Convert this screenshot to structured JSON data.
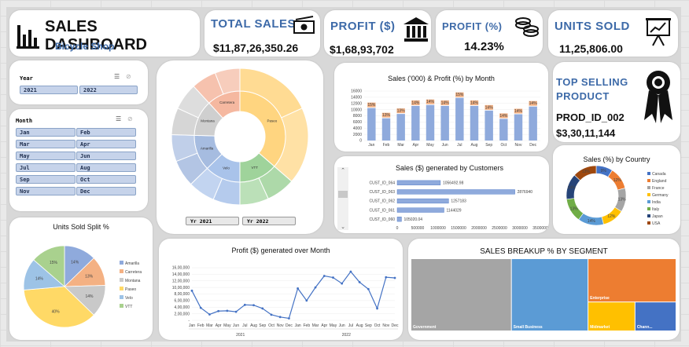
{
  "header": {
    "title": "SALES DASHBOARD",
    "subtitle": "Bicycle Shop",
    "icon": "bar-chart-icon"
  },
  "kpis": {
    "total_sales": {
      "label": "TOTAL SALES",
      "value": "$11,87,26,350.26",
      "icon": "cash-icon"
    },
    "profit_amt": {
      "label": "PROFIT ($)",
      "value": "$1,68,93,702",
      "icon": "bank-icon"
    },
    "profit_pct": {
      "label": "PROFIT (%)",
      "value": "14.23%",
      "icon": "coins-icon"
    },
    "units_sold": {
      "label": "UNITS SOLD",
      "value": "11,25,806.00",
      "icon": "presentation-icon"
    }
  },
  "top_product": {
    "label": "TOP SELLING PRODUCT",
    "product": "PROD_ID_002",
    "value": "$3,30,11,144",
    "icon": "award-ribbon-icon"
  },
  "slicers": {
    "year": {
      "title": "Year",
      "items": [
        "2021",
        "2022"
      ]
    },
    "month": {
      "title": "Month",
      "items": [
        "Jan",
        "Feb",
        "Mar",
        "Apr",
        "May",
        "Jun",
        "Jul",
        "Aug",
        "Sep",
        "Oct",
        "Nov",
        "Dec"
      ]
    }
  },
  "donut_tabs": [
    "Yr 2021",
    "Yr 2022"
  ],
  "colors": {
    "bar_blue": "#8faadc",
    "bar_orange": "#f4b183",
    "line_blue": "#4472c4",
    "treemap_gov": "#a5a5a5",
    "treemap_small": "#5b9bd5",
    "treemap_ent": "#ed7d31",
    "treemap_mid": "#ffc000",
    "treemap_chan": "#4472c4"
  },
  "chart_data": [
    {
      "id": "sunburst",
      "type": "pie",
      "title": "",
      "rings": {
        "inner": [
          {
            "name": "Paseo",
            "value": 40,
            "color": "#ffd580"
          },
          {
            "name": "VTT",
            "value": 15,
            "color": "#9fd39b"
          },
          {
            "name": "Velo",
            "value": 14,
            "color": "#a9c3ea"
          },
          {
            "name": "Amarilla",
            "value": 14,
            "color": "#a6bce0"
          },
          {
            "name": "Montana",
            "value": 14,
            "color": "#cfcfcf"
          },
          {
            "name": "Carretera",
            "value": 13,
            "color": "#f5b8a0"
          }
        ]
      }
    },
    {
      "id": "sales_profit_month",
      "type": "bar",
      "title": "Sales ('000) & Profit (%) by Month",
      "categories": [
        "Jan",
        "Feb",
        "Mar",
        "Apr",
        "May",
        "Jun",
        "Jul",
        "Aug",
        "Sep",
        "Oct",
        "Nov",
        "Dec"
      ],
      "series": [
        {
          "values": [
            10500,
            7200,
            8600,
            11200,
            11500,
            11200,
            13800,
            11200,
            9700,
            7000,
            8500,
            11000
          ],
          "color": "#8faadc"
        },
        {
          "values": [
            15,
            13,
            13,
            14,
            14,
            14,
            15,
            14,
            14,
            14,
            14,
            14
          ],
          "color": "#f4b183"
        }
      ],
      "ylim": [
        0,
        16000
      ],
      "yticks": [
        0,
        2000,
        4000,
        6000,
        8000,
        10000,
        12000,
        14000,
        16000
      ]
    },
    {
      "id": "sales_customers",
      "type": "bar",
      "title": "Sales ($) generated by Customers",
      "categories": [
        "CUST_ID_064",
        "CUST_ID_063",
        "CUST_ID_062",
        "CUST_ID_061",
        "CUST_ID_060"
      ],
      "values": [
        1056492.98,
        2876940,
        1257183,
        1144029,
        105020.04
      ],
      "labels": [
        "1056492.98",
        "2876940",
        "1257183",
        "1144029",
        "105020.04"
      ],
      "xlim": [
        0,
        3500000
      ],
      "xticks": [
        "0",
        "500000",
        "1000000",
        "1500000",
        "2000000",
        "2500000",
        "3000000",
        "3500000"
      ]
    },
    {
      "id": "sales_country",
      "type": "pie",
      "title": "Sales (%) by Country",
      "categories": [
        "Canada",
        "England",
        "France",
        "Germany",
        "India",
        "Italy",
        "Japan",
        "USA"
      ],
      "values": [
        9,
        12,
        13,
        12,
        14,
        13,
        14,
        13
      ],
      "labels": [
        "9%",
        "12%",
        "13%",
        "12%",
        "14%",
        "13%",
        "14%",
        "13%"
      ],
      "colors": [
        "#4472c4",
        "#ed7d31",
        "#a5a5a5",
        "#ffc000",
        "#5b9bd5",
        "#70ad47",
        "#264478",
        "#9e480e"
      ]
    },
    {
      "id": "units_split",
      "type": "pie",
      "title": "Units Sold Split %",
      "categories": [
        "Amarilla",
        "Carretera",
        "Montana",
        "Paseo",
        "Velo",
        "VTT"
      ],
      "values": [
        14,
        13,
        14,
        40,
        14,
        15
      ],
      "labels": [
        "14%",
        "13%",
        "14%",
        "40%",
        "14%",
        "15%"
      ],
      "colors": [
        "#8faadc",
        "#f4b183",
        "#c9c9c9",
        "#ffd966",
        "#9dc3e6",
        "#a9d18e"
      ]
    },
    {
      "id": "profit_month",
      "type": "line",
      "title": "Profit ($) generated over Month",
      "categories": [
        "Jan",
        "Feb",
        "Mar",
        "Apr",
        "May",
        "Jun",
        "Jul",
        "Aug",
        "Sep",
        "Oct",
        "Nov",
        "Dec",
        "Jan",
        "Feb",
        "Mar",
        "Apr",
        "May",
        "Jun",
        "Jul",
        "Aug",
        "Sep",
        "Oct",
        "Nov",
        "Dec"
      ],
      "groups": [
        "2021",
        "2022"
      ],
      "values": [
        900000,
        380000,
        180000,
        280000,
        290000,
        260000,
        470000,
        460000,
        360000,
        170000,
        100000,
        60000,
        970000,
        600000,
        1000000,
        1350000,
        1300000,
        1120000,
        1480000,
        1160000,
        950000,
        360000,
        1310000,
        1290000
      ],
      "ylim": [
        0,
        1600000
      ],
      "yticks": [
        "-",
        "2,00,000",
        "4,00,000",
        "6,00,000",
        "8,00,000",
        "10,00,000",
        "12,00,000",
        "14,00,000",
        "16,00,000"
      ]
    },
    {
      "id": "segment_treemap",
      "type": "heatmap",
      "title": "SALES BREAKUP % BY SEGMENT",
      "categories": [
        "Government",
        "Small Business",
        "Enterprise",
        "Midmarket",
        "Chann..."
      ],
      "values": [
        38,
        29,
        20,
        7,
        6
      ]
    }
  ]
}
